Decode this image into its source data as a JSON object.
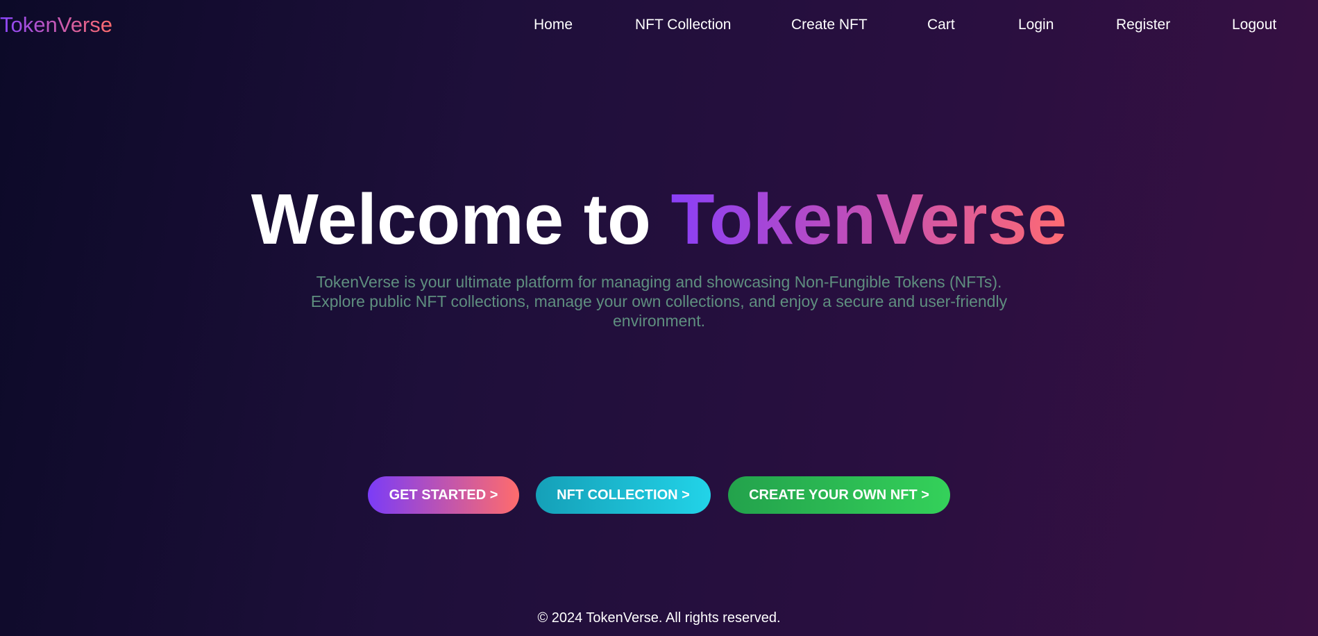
{
  "brand": {
    "name": "TokenVerse"
  },
  "nav": {
    "items": [
      {
        "label": "Home"
      },
      {
        "label": "NFT Collection"
      },
      {
        "label": "Create NFT"
      },
      {
        "label": "Cart"
      },
      {
        "label": "Login"
      },
      {
        "label": "Register"
      },
      {
        "label": "Logout"
      }
    ]
  },
  "hero": {
    "title_prefix": "Welcome to",
    "title_highlight": "TokenVerse",
    "description": "TokenVerse is your ultimate platform for managing and showcasing Non-Fungible Tokens (NFTs). Explore public NFT collections, manage your own collections, and enjoy a secure and user-friendly environment."
  },
  "cta": {
    "get_started": "GET STARTED >",
    "nft_collection": "NFT COLLECTION >",
    "create_nft": "CREATE YOUR OWN NFT >"
  },
  "footer": {
    "text": "© 2024 TokenVerse. All rights reserved."
  },
  "colors": {
    "background_start": "#0c0a28",
    "background_end": "#3a1043",
    "brand_gradient_start": "#8a46ff",
    "brand_gradient_end": "#ff6b6b",
    "description_text": "#5f8f7f",
    "cta_start_gradient": [
      "#7b3cf7",
      "#ff6c6c"
    ],
    "cta_collection_gradient": [
      "#15a0b8",
      "#22d3e8"
    ],
    "cta_create_gradient": [
      "#23a24c",
      "#34d15a"
    ]
  }
}
